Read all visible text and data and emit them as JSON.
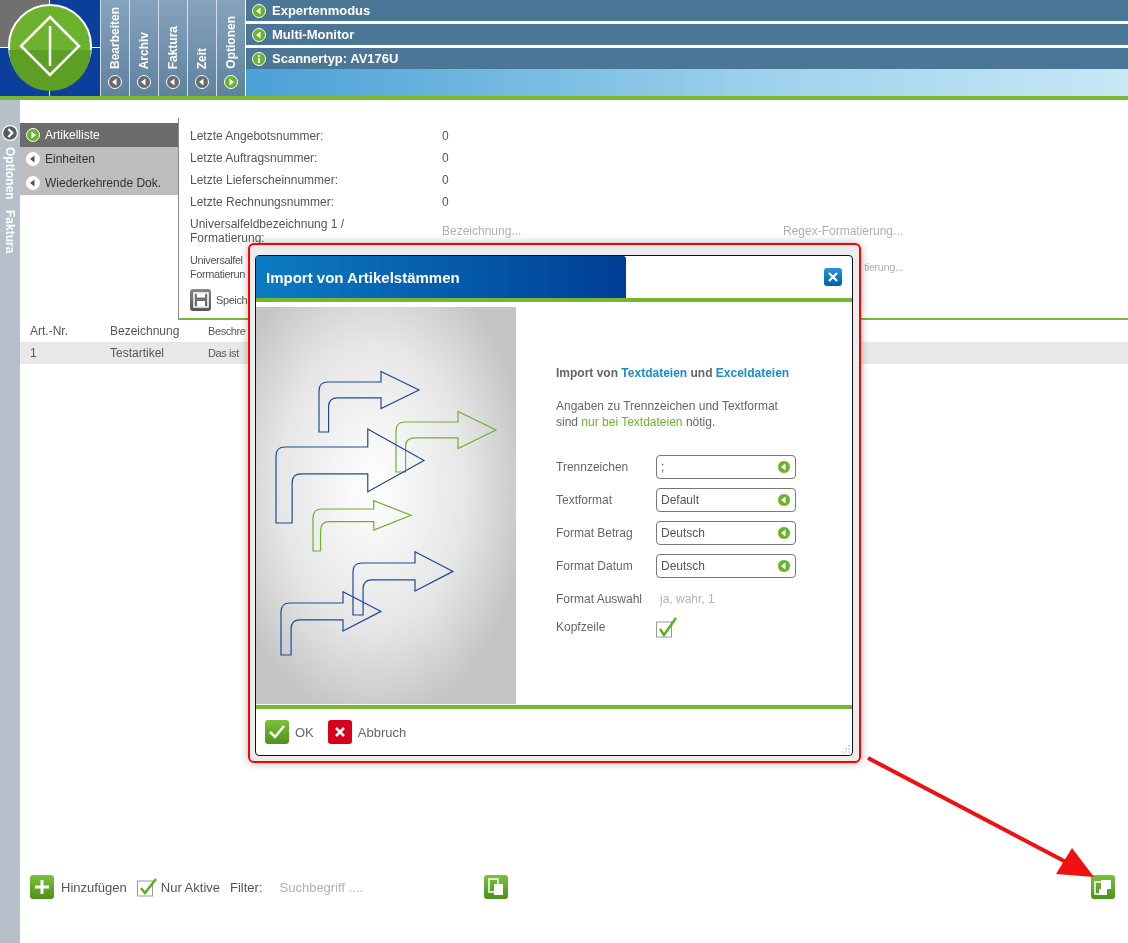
{
  "header": {
    "tabs": [
      {
        "label": "Bearbeiten",
        "selected": false
      },
      {
        "label": "Archiv",
        "selected": false
      },
      {
        "label": "Faktura",
        "selected": false
      },
      {
        "label": "Zeit",
        "selected": false
      },
      {
        "label": "Optionen",
        "selected": true
      }
    ],
    "menu": [
      {
        "label": "Expertenmodus",
        "kind": "toggle"
      },
      {
        "label": "Multi-Monitor",
        "kind": "toggle"
      },
      {
        "label": "Scannertyp: AV176U",
        "kind": "info"
      }
    ]
  },
  "side_strip": {
    "labels": [
      "Optionen",
      "Faktura"
    ]
  },
  "nav": [
    {
      "label": "Artikelliste",
      "selected": true
    },
    {
      "label": "Einheiten",
      "selected": false
    },
    {
      "label": "Wiederkehrende Dok.",
      "selected": false
    }
  ],
  "settings": {
    "rows": [
      {
        "label": "Letzte Angebotsnummer:",
        "value": "0"
      },
      {
        "label": "Letzte Auftragsnummer:",
        "value": "0"
      },
      {
        "label": "Letzte Lieferscheinnummer:",
        "value": "0"
      },
      {
        "label": "Letzte Rechnungsnummer:",
        "value": "0"
      },
      {
        "label_lines": [
          "Universalfeldbezeichnung 1 /",
          "Formatierung:"
        ],
        "placeholder": "Bezeichnung...",
        "regex_placeholder": "Regex-Formatierung..."
      },
      {
        "label_lines": [
          "Universalfel",
          "Formatierun"
        ],
        "regex_placeholder": "tierung..."
      }
    ],
    "save": "Speich"
  },
  "table": {
    "columns": [
      "Art.-Nr.",
      "Bezeichnung",
      "Beschre"
    ],
    "rows": [
      [
        "1",
        "Testartikel",
        "Das ist"
      ]
    ]
  },
  "toolbar": {
    "add": "Hinzufügen",
    "only_active": {
      "label": "Nur Aktive",
      "checked": true
    },
    "filter_label": "Filter:",
    "filter_placeholder": "Suchbegriff ...."
  },
  "dialog": {
    "title": "Import von Artikelstämmen",
    "heading": [
      {
        "text": "Import von "
      },
      {
        "text": "Textdateien",
        "color": "#1a8ccc"
      },
      {
        "text": " und "
      },
      {
        "text": "Exceldateien",
        "color": "#1a8ccc"
      }
    ],
    "description": [
      {
        "text": "Angaben zu Trennzeichen und Textformat sind "
      },
      {
        "text": "nur bei Textdateien",
        "color": "#6db22d"
      },
      {
        "text": " nötig."
      }
    ],
    "fields": [
      {
        "label": "Trennzeichen",
        "kind": "select",
        "value": ";"
      },
      {
        "label": "Textformat",
        "kind": "select",
        "value": "Default"
      },
      {
        "label": "Format Betrag",
        "kind": "select",
        "value": "Deutsch"
      },
      {
        "label": "Format Datum",
        "kind": "select",
        "value": "Deutsch"
      },
      {
        "label": "Format Auswahl",
        "kind": "text",
        "placeholder": "ja, wahr, 1"
      },
      {
        "label": "Kopfzeile",
        "kind": "checkbox",
        "checked": true
      }
    ],
    "buttons": [
      {
        "label": "OK",
        "kind": "ok"
      },
      {
        "label": "Abbruch",
        "kind": "cancel"
      }
    ]
  }
}
